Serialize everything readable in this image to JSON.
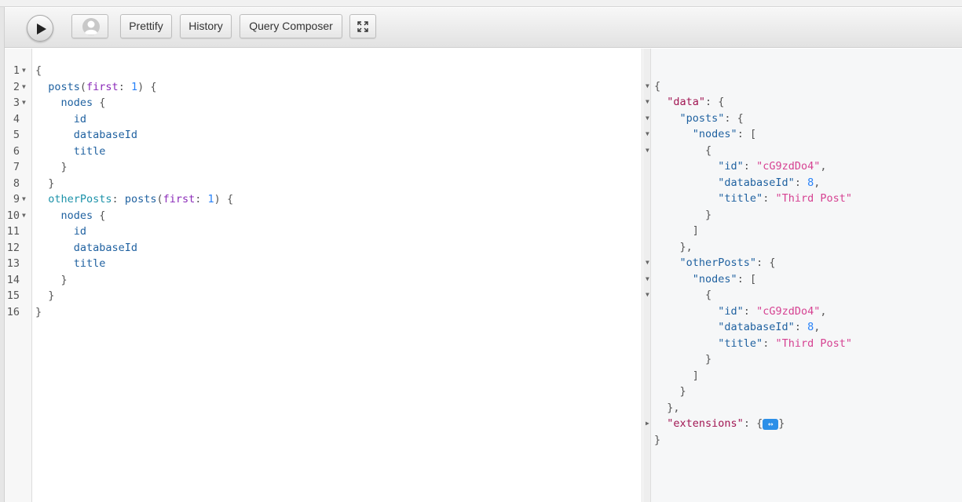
{
  "toolbar": {
    "prettify_label": "Prettify",
    "history_label": "History",
    "composer_label": "Query Composer"
  },
  "query": {
    "lines": [
      {
        "n": "1",
        "text": "{"
      },
      {
        "n": "2",
        "text": "  posts(first: 1) {"
      },
      {
        "n": "3",
        "text": "    nodes {"
      },
      {
        "n": "4",
        "text": "      id"
      },
      {
        "n": "5",
        "text": "      databaseId"
      },
      {
        "n": "6",
        "text": "      title"
      },
      {
        "n": "7",
        "text": "    }"
      },
      {
        "n": "8",
        "text": "  }"
      },
      {
        "n": "9",
        "text": "  otherPosts: posts(first: 1) {"
      },
      {
        "n": "10",
        "text": "    nodes {"
      },
      {
        "n": "11",
        "text": "      id"
      },
      {
        "n": "12",
        "text": "      databaseId"
      },
      {
        "n": "13",
        "text": "      title"
      },
      {
        "n": "14",
        "text": "    }"
      },
      {
        "n": "15",
        "text": "  }"
      },
      {
        "n": "16",
        "text": "}"
      }
    ],
    "fold_lines": [
      "1",
      "2",
      "3",
      "9",
      "10"
    ]
  },
  "response": {
    "data_key": "\"data\"",
    "posts_key": "\"posts\"",
    "other_posts_key": "\"otherPosts\"",
    "nodes_key": "\"nodes\"",
    "id_key": "\"id\"",
    "id_value": "\"cG9zdDo4\"",
    "database_id_key": "\"databaseId\"",
    "database_id_value": "8",
    "title_key": "\"title\"",
    "title_value": "\"Third Post\"",
    "extensions_key": "\"extensions\"",
    "extensions_collapsed": "↔"
  },
  "colors": {
    "field": "#1f61a0",
    "argument": "#8b2bb9",
    "number": "#2882f9",
    "string": "#d64292",
    "result_key": "#a11552"
  }
}
